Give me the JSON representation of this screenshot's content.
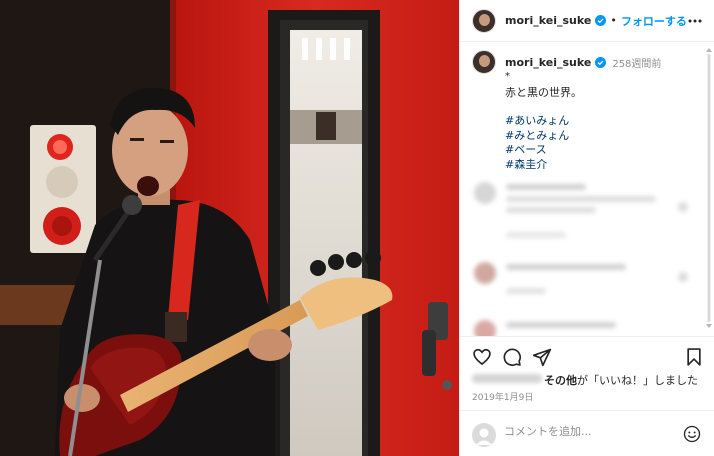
{
  "header": {
    "username": "mori_kei_suke",
    "separator": "•",
    "follow_label": "フォローする"
  },
  "caption": {
    "username": "mori_kei_suke",
    "time_ago": "258週間前",
    "dot": "*",
    "text": "赤と黒の世界。",
    "hashtags": [
      "#あいみょん",
      "#みとみょん",
      "#ベース",
      "#森圭介"
    ]
  },
  "likes": {
    "text_bold": "その他",
    "text_rest": "が「いいね！」しました"
  },
  "date": "2019年1月9日",
  "comment_box": {
    "placeholder": "コメントを追加..."
  },
  "icons": {
    "verified": "verified-badge-icon",
    "more": "more-options-icon",
    "like": "heart-icon",
    "comment": "comment-icon",
    "share": "share-icon",
    "save": "bookmark-icon",
    "emoji": "emoji-icon"
  },
  "colors": {
    "link_blue": "#0095f6",
    "hashtag": "#00376b",
    "muted": "#8e8e8e",
    "wall_red": "#d4221c"
  }
}
